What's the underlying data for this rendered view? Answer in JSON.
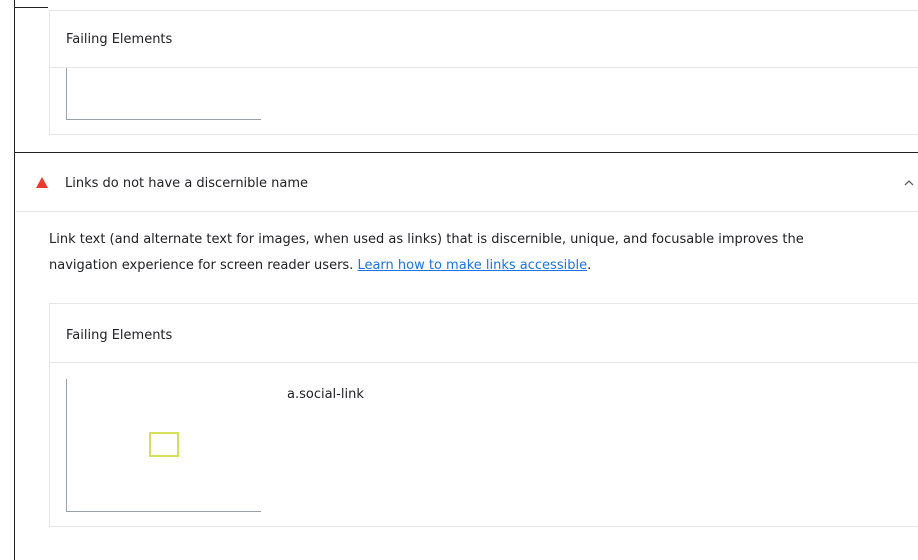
{
  "sections": {
    "top_failing": {
      "title": "Failing Elements"
    },
    "audit": {
      "title": "Links do not have a discernible name",
      "description_text": "Link text (and alternate text for images, when used as links) that is discernible, unique, and focusable improves the navigation experience for screen reader users. ",
      "learn_link": "Learn how to make links accessible",
      "description_end": ".",
      "failing": {
        "title": "Failing Elements",
        "node_selector": "a.social-link"
      }
    }
  },
  "icons": {
    "warning": "warning-triangle-icon",
    "collapse": "chevron-up-icon"
  },
  "colors": {
    "warning": "#eb3b2e",
    "link": "#1a73e8",
    "highlight": "#d4e157",
    "border": "#e6e6e6"
  }
}
